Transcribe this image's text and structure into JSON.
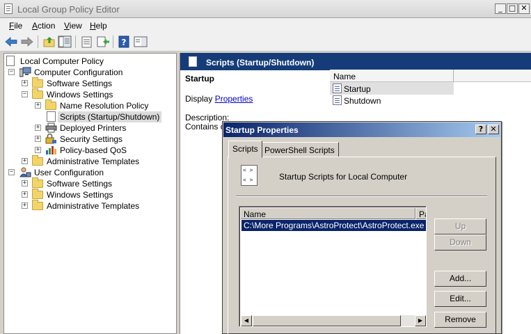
{
  "window": {
    "title": "Local Group Policy Editor",
    "controls": [
      "_",
      "□",
      "✕"
    ]
  },
  "menu": [
    {
      "label": "File",
      "accel": "F",
      "rest": "ile"
    },
    {
      "label": "Action",
      "accel": "A",
      "rest": "ction"
    },
    {
      "label": "View",
      "accel": "V",
      "rest": "iew"
    },
    {
      "label": "Help",
      "accel": "H",
      "rest": "elp"
    }
  ],
  "toolbar": [
    "back-icon",
    "forward-icon",
    "up-folder-icon",
    "show-hide-tree-icon",
    "properties-icon",
    "export-list-icon",
    "help-icon",
    "action-pane-icon"
  ],
  "tree": {
    "root": "Local Computer Policy",
    "computer_config": "Computer Configuration",
    "cc_software": "Software Settings",
    "cc_windows": "Windows Settings",
    "name_resolution": "Name Resolution Policy",
    "scripts": "Scripts (Startup/Shutdown)",
    "printers": "Deployed Printers",
    "security": "Security Settings",
    "qos": "Policy-based QoS",
    "cc_admin": "Administrative Templates",
    "user_config": "User Configuration",
    "uc_software": "Software Settings",
    "uc_windows": "Windows Settings",
    "uc_admin": "Administrative Templates"
  },
  "details": {
    "header": "Scripts (Startup/Shutdown)",
    "item_title": "Startup",
    "display_prefix": "Display ",
    "display_link": "Properties",
    "description_label": "Description:",
    "contains_text": "Contains configuration",
    "column_name": "Name",
    "items": [
      "Startup",
      "Shutdown"
    ]
  },
  "dialog": {
    "title": "Startup Properties",
    "help_btn": "?",
    "close_btn": "✕",
    "tabs": [
      "Scripts",
      "PowerShell Scripts"
    ],
    "subtitle": "Startup Scripts for Local Computer",
    "col_name": "Name",
    "col_params": "Parameters",
    "scripts": [
      {
        "name": "C:\\More Programs\\AstroProtect\\AstroProtect.exe"
      }
    ],
    "buttons": {
      "up": "Up",
      "down": "Down",
      "add": "Add...",
      "edit": "Edit...",
      "remove": "Remove"
    }
  }
}
